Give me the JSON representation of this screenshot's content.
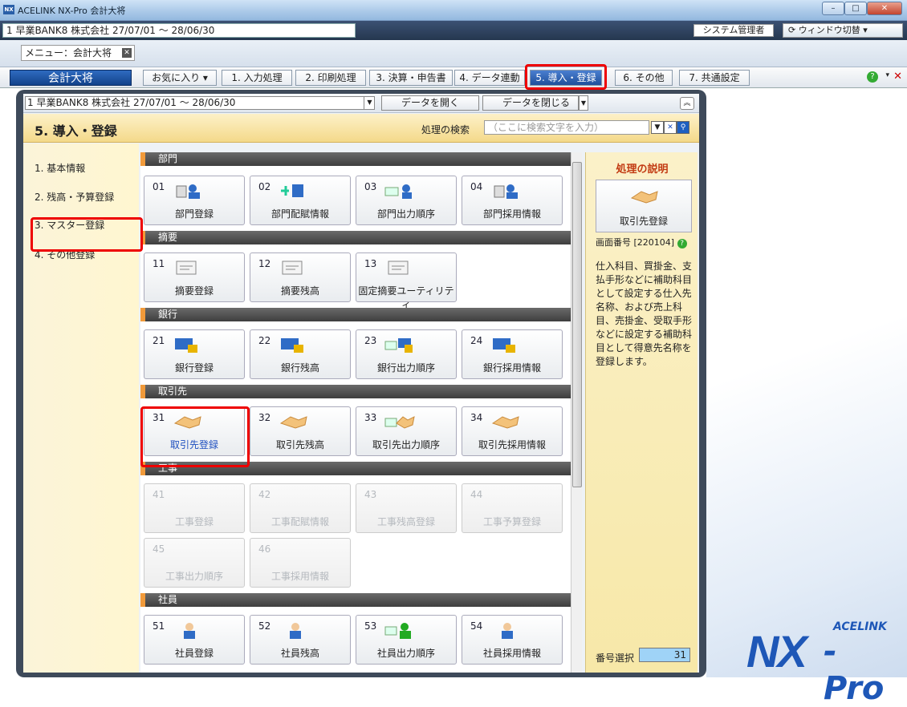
{
  "window": {
    "title": "ACELINK NX-Pro 会計大将",
    "company": "1 早業BANK8  株式会社 27/07/01 ～ 28/06/30",
    "user": "システム管理者",
    "window_switch": "ウィンドウ切替"
  },
  "menu_tab": {
    "label": "メニュー：会計大将"
  },
  "app_button": "会計大将",
  "main_tabs": [
    "お気に入り",
    "1. 入力処理",
    "2. 印刷処理",
    "3. 決算・申告書",
    "4. データ連動",
    "5. 導入・登録",
    "6. その他",
    "7. 共通設定"
  ],
  "panel": {
    "company": "1 早業BANK8  株式会社 27/07/01 ～ 28/06/30",
    "open_data": "データを開く",
    "close_data": "データを閉じる",
    "page_title": "5. 導入・登録",
    "search_label": "処理の検索",
    "search_placeholder": "（ここに検索文字を入力）"
  },
  "left_nav": [
    "1. 基本情報",
    "2. 残高・予算登録",
    "3. マスター登録",
    "4. その他登録"
  ],
  "sections": [
    {
      "title": "部門",
      "tiles": [
        {
          "num": "01",
          "label": "部門登録"
        },
        {
          "num": "02",
          "label": "部門配賦情報"
        },
        {
          "num": "03",
          "label": "部門出力順序"
        },
        {
          "num": "04",
          "label": "部門採用情報"
        }
      ]
    },
    {
      "title": "摘要",
      "tiles": [
        {
          "num": "11",
          "label": "摘要登録"
        },
        {
          "num": "12",
          "label": "摘要残高"
        },
        {
          "num": "13",
          "label": "固定摘要ユーティリティ"
        }
      ]
    },
    {
      "title": "銀行",
      "tiles": [
        {
          "num": "21",
          "label": "銀行登録"
        },
        {
          "num": "22",
          "label": "銀行残高"
        },
        {
          "num": "23",
          "label": "銀行出力順序"
        },
        {
          "num": "24",
          "label": "銀行採用情報"
        }
      ]
    },
    {
      "title": "取引先",
      "tiles": [
        {
          "num": "31",
          "label": "取引先登録"
        },
        {
          "num": "32",
          "label": "取引先残高"
        },
        {
          "num": "33",
          "label": "取引先出力順序"
        },
        {
          "num": "34",
          "label": "取引先採用情報"
        }
      ]
    },
    {
      "title": "工事",
      "tiles": [
        {
          "num": "41",
          "label": "工事登録"
        },
        {
          "num": "42",
          "label": "工事配賦情報"
        },
        {
          "num": "43",
          "label": "工事残高登録"
        },
        {
          "num": "44",
          "label": "工事予算登録"
        },
        {
          "num": "45",
          "label": "工事出力順序"
        },
        {
          "num": "46",
          "label": "工事採用情報"
        }
      ]
    },
    {
      "title": "社員",
      "tiles": [
        {
          "num": "51",
          "label": "社員登録"
        },
        {
          "num": "52",
          "label": "社員残高"
        },
        {
          "num": "53",
          "label": "社員出力順序"
        },
        {
          "num": "54",
          "label": "社員採用情報"
        }
      ]
    }
  ],
  "description": {
    "title": "処理の説明",
    "selected_label": "取引先登録",
    "screen_no": "画面番号 [220104]",
    "text": "仕入科目、買掛金、支払手形などに補助科目として設定する仕入先名称、および売上科目、売掛金、受取手形などに設定する補助科目として得意先名称を登録します。",
    "number_select_label": "番号選択",
    "number_select_value": "31"
  },
  "logo": {
    "brand": "ACELINK",
    "nx": "NX",
    "pro": "-Pro"
  }
}
